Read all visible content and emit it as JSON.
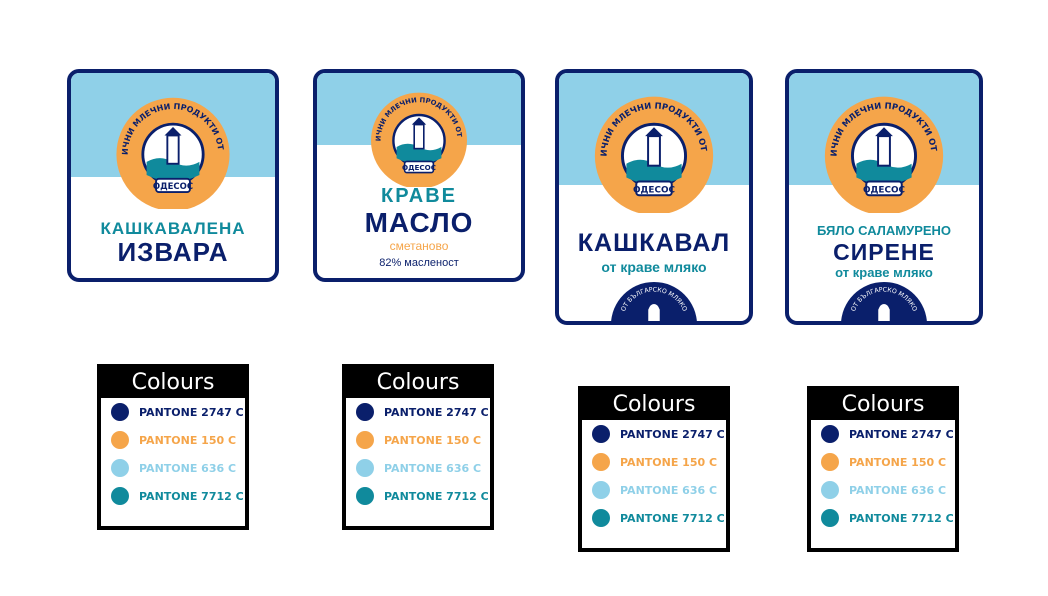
{
  "colors": {
    "navy": "#0a1f6b",
    "orange": "#f5a54a",
    "light_blue": "#8fd0e8",
    "teal": "#108a9c"
  },
  "brand": {
    "arc_text": "АВТЕНТИЧНИ МЛЕЧНИ ПРОДУКТИ ОТ ИЗВОРА",
    "name": "ОДЕСОС",
    "origin_text": "ОТ БЪЛГАРСКО МЛЯКО"
  },
  "labels": [
    {
      "lines": [
        "КАШКАВАЛЕНА",
        "ИЗВАРА"
      ]
    },
    {
      "lines": [
        "КРАВЕ",
        "МАСЛО",
        "сметаново",
        "82% масленост"
      ]
    },
    {
      "lines": [
        "КАШКАВАЛ",
        "от краве мляко"
      ]
    },
    {
      "lines": [
        "БЯЛО САЛАМУРЕНО",
        "СИРЕНЕ",
        "от краве мляко"
      ]
    }
  ],
  "colour_panel": {
    "title": "Colours",
    "swatches": [
      {
        "name": "PANTONE 2747 C",
        "color": "#0a1f6b"
      },
      {
        "name": "PANTONE 150 C",
        "color": "#f5a54a"
      },
      {
        "name": "PANTONE 636 C",
        "color": "#8fd0e8"
      },
      {
        "name": "PANTONE 7712 C",
        "color": "#108a9c"
      }
    ]
  }
}
